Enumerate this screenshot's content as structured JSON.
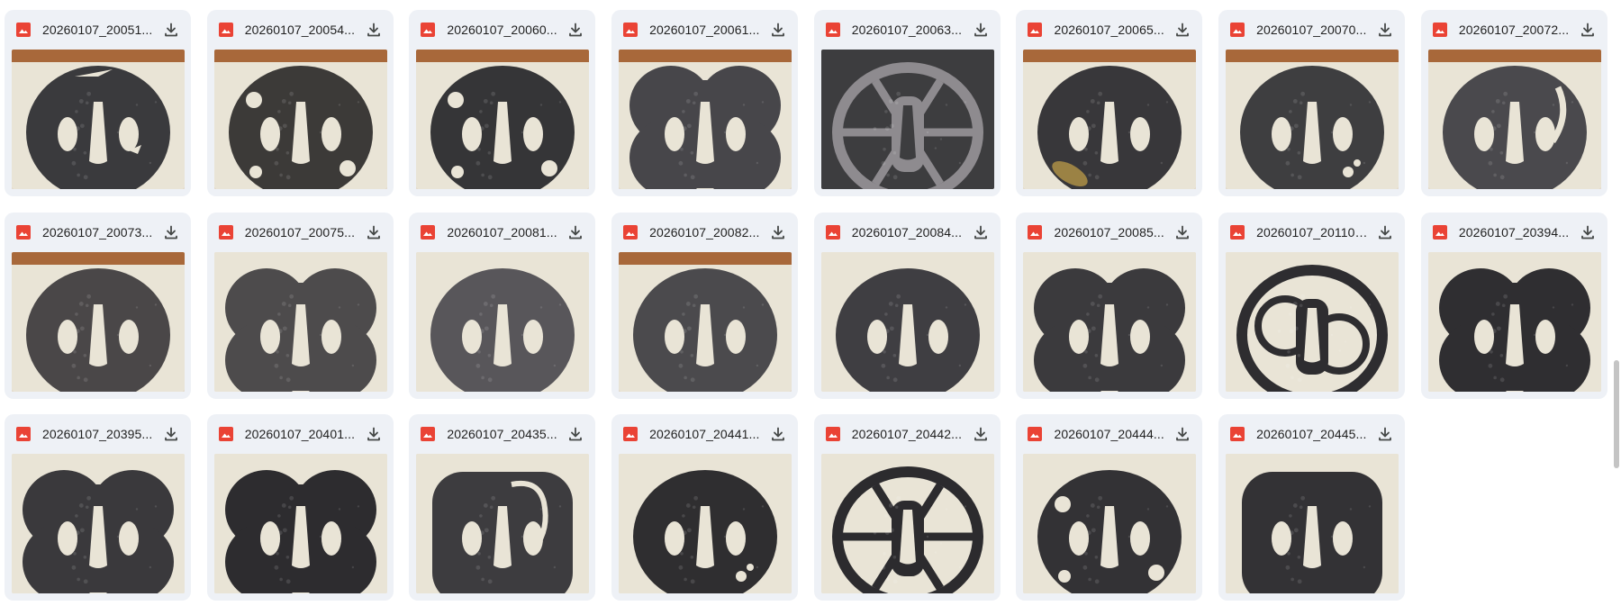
{
  "files": [
    {
      "name": "20260107_200515.jpg",
      "display": "20260107_20051...",
      "bg": "wood",
      "shape": "round",
      "metal": "#3a3a3d",
      "pierce": "birds"
    },
    {
      "name": "20260107_200545.jpg",
      "display": "20260107_20054...",
      "bg": "wood",
      "shape": "round",
      "metal": "#3c3a38",
      "pierce": "leaves"
    },
    {
      "name": "20260107_200600.jpg",
      "display": "20260107_20060...",
      "bg": "wood",
      "shape": "round",
      "metal": "#353537",
      "pierce": "mokko"
    },
    {
      "name": "20260107_200615.jpg",
      "display": "20260107_20061...",
      "bg": "wood",
      "shape": "mokko",
      "metal": "#47464a",
      "pierce": "none"
    },
    {
      "name": "20260107_200630.jpg",
      "display": "20260107_20063...",
      "bg": "dark",
      "shape": "open",
      "metal": "#8e8b8f",
      "pierce": "lattice"
    },
    {
      "name": "20260107_200655.jpg",
      "display": "20260107_20065...",
      "bg": "wood",
      "shape": "round",
      "metal": "#38373a",
      "pierce": "brass"
    },
    {
      "name": "20260107_200705.jpg",
      "display": "20260107_20070...",
      "bg": "wood",
      "shape": "round",
      "metal": "#3e3e40",
      "pierce": "small"
    },
    {
      "name": "20260107_200725.jpg",
      "display": "20260107_20072...",
      "bg": "wood",
      "shape": "round",
      "metal": "#4a494d",
      "pierce": "hook"
    },
    {
      "name": "20260107_200735.jpg",
      "display": "20260107_20073...",
      "bg": "wood",
      "shape": "round",
      "metal": "#4a4748",
      "pierce": "none"
    },
    {
      "name": "20260107_200755.jpg",
      "display": "20260107_20075...",
      "bg": "cloth",
      "shape": "mokko",
      "metal": "#4d4b4c",
      "pierce": "none"
    },
    {
      "name": "20260107_200815.jpg",
      "display": "20260107_20081...",
      "bg": "cloth",
      "shape": "round",
      "metal": "#58565a",
      "pierce": "none"
    },
    {
      "name": "20260107_200825.jpg",
      "display": "20260107_20082...",
      "bg": "wood",
      "shape": "round",
      "metal": "#4b4a4d",
      "pierce": "none"
    },
    {
      "name": "20260107_200845.jpg",
      "display": "20260107_20084...",
      "bg": "cloth",
      "shape": "round",
      "metal": "#3f3e42",
      "pierce": "none"
    },
    {
      "name": "20260107_200855.jpg",
      "display": "20260107_20085...",
      "bg": "cloth",
      "shape": "mokko",
      "metal": "#3b3a3d",
      "pierce": "none"
    },
    {
      "name": "20260107_201107.jpg",
      "display": "20260107_201107...",
      "bg": "cloth",
      "shape": "open",
      "metal": "#2e2d30",
      "pierce": "rings"
    },
    {
      "name": "20260107_203945.jpg",
      "display": "20260107_20394...",
      "bg": "cloth",
      "shape": "mokko",
      "metal": "#2f2e31",
      "pierce": "none"
    },
    {
      "name": "20260107_203955.jpg",
      "display": "20260107_20395...",
      "bg": "cloth",
      "shape": "mokko",
      "metal": "#3a393c",
      "pierce": "none"
    },
    {
      "name": "20260107_204015.jpg",
      "display": "20260107_20401...",
      "bg": "cloth",
      "shape": "mokko",
      "metal": "#2d2c2f",
      "pierce": "none"
    },
    {
      "name": "20260107_204355.jpg",
      "display": "20260107_20435...",
      "bg": "cloth",
      "shape": "square",
      "metal": "#3d3c3f",
      "pierce": "dragon"
    },
    {
      "name": "20260107_204415.jpg",
      "display": "20260107_20441...",
      "bg": "cloth",
      "shape": "round",
      "metal": "#2f2e30",
      "pierce": "small"
    },
    {
      "name": "20260107_204425.jpg",
      "display": "20260107_20442...",
      "bg": "cloth",
      "shape": "open",
      "metal": "#2c2b2e",
      "pierce": "wheel"
    },
    {
      "name": "20260107_204445.jpg",
      "display": "20260107_20444...",
      "bg": "cloth",
      "shape": "round",
      "metal": "#333235",
      "pierce": "mokko"
    },
    {
      "name": "20260107_204455.jpg",
      "display": "20260107_20445...",
      "bg": "cloth",
      "shape": "square",
      "metal": "#333235",
      "pierce": "lattice"
    }
  ],
  "colors": {
    "card": "#eef1f6",
    "file_icon": "#ea4335",
    "text": "#1f1f1f",
    "icon": "#444746",
    "wood": "#a8683a",
    "cloth": "#e9e4d6",
    "dark": "#3d3d3f"
  }
}
